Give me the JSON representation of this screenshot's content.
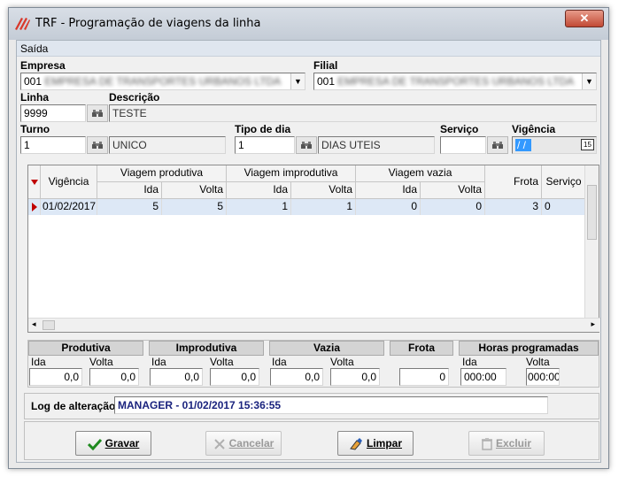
{
  "window": {
    "title": "TRF - Programação de viagens da linha",
    "close_label": "✕"
  },
  "menu": {
    "items": [
      {
        "label": "Saída"
      }
    ]
  },
  "empresa": {
    "label": "Empresa",
    "code": "001",
    "name": "EMPRESA DE TRANSPORTES URBANOS LTDA"
  },
  "filial": {
    "label": "Filial",
    "code": "001",
    "name": "EMPRESA DE TRANSPORTES URBANOS LTDA"
  },
  "linha": {
    "label": "Linha",
    "value": "9999"
  },
  "descricao": {
    "label": "Descrição",
    "value": "TESTE"
  },
  "turno": {
    "label": "Turno",
    "code": "1",
    "name": "UNICO"
  },
  "tipo_dia": {
    "label": "Tipo de dia",
    "code": "1",
    "name": "DIAS UTEIS"
  },
  "servico": {
    "label": "Serviço",
    "value": ""
  },
  "vigencia": {
    "label": "Vigência",
    "value": " /  /",
    "calendar_label": "15"
  },
  "grid": {
    "headers": {
      "vigencia": "Vigência",
      "viagem_produtiva": "Viagem produtiva",
      "viagem_improdutiva": "Viagem improdutiva",
      "viagem_vazia": "Viagem vazia",
      "ida": "Ida",
      "volta": "Volta",
      "frota": "Frota",
      "servico": "Serviço"
    },
    "rows": [
      {
        "vigencia": "01/02/2017",
        "prod_ida": "5",
        "prod_volta": "5",
        "improd_ida": "1",
        "improd_volta": "1",
        "vazia_ida": "0",
        "vazia_volta": "0",
        "frota": "3",
        "servico": "0"
      }
    ]
  },
  "totals": {
    "produtiva": {
      "title": "Produtiva",
      "ida_label": "Ida",
      "volta_label": "Volta",
      "ida": "0,0",
      "volta": "0,0"
    },
    "improdutiva": {
      "title": "Improdutiva",
      "ida_label": "Ida",
      "volta_label": "Volta",
      "ida": "0,0",
      "volta": "0,0"
    },
    "vazia": {
      "title": "Vazia",
      "ida_label": "Ida",
      "volta_label": "Volta",
      "ida": "0,0",
      "volta": "0,0"
    },
    "frota": {
      "title": "Frota",
      "value": "0"
    },
    "horas": {
      "title": "Horas programadas",
      "ida_label": "Ida",
      "volta_label": "Volta",
      "ida": "000:00",
      "volta": "000:00"
    }
  },
  "log": {
    "label": "Log de alteração",
    "value": "MANAGER - 01/02/2017 15:36:55"
  },
  "buttons": {
    "gravar": {
      "label": "Gravar",
      "enabled": true
    },
    "cancelar": {
      "label": "Cancelar",
      "enabled": false
    },
    "limpar": {
      "label": "Limpar",
      "enabled": true
    },
    "excluir": {
      "label": "Excluir",
      "enabled": false
    }
  },
  "colors": {
    "selection_row": "#dde8f6",
    "vigencia_highlight": "#3399ff",
    "log_text": "#1a237e",
    "row_marker": "#c00000"
  }
}
